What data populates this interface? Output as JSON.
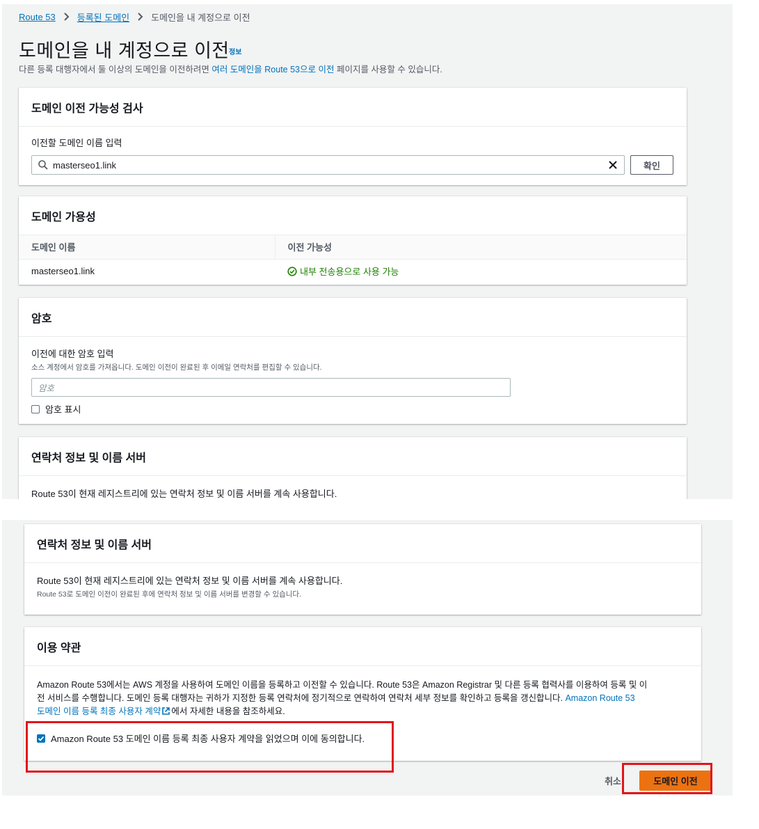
{
  "breadcrumb": {
    "root": "Route 53",
    "registered": "등록된 도메인",
    "current": "도메인을 내 계정으로 이전"
  },
  "header": {
    "title": "도메인을 내 계정으로 이전",
    "info": "정보",
    "subtitle_pre": "다른 등록 대행자에서 둘 이상의 도메인을 이전하려면 ",
    "subtitle_link": "여러 도메인을 Route 53으로 이전",
    "subtitle_post": " 페이지를 사용할 수 있습니다."
  },
  "check_panel": {
    "title": "도메인 이전 가능성 검사",
    "input_label": "이전할 도메인 이름 입력",
    "input_value": "masterseo1.link",
    "confirm_label": "확인"
  },
  "availability_panel": {
    "title": "도메인 가용성",
    "columns": [
      "도메인 이름",
      "이전 가능성"
    ],
    "rows": [
      {
        "domain": "masterseo1.link",
        "status": "내부 전송용으로 사용 가능"
      }
    ]
  },
  "password_panel": {
    "title": "암호",
    "label": "이전에 대한 암호 입력",
    "description": "소스 계정에서 암호를 가져옵니다. 도메인 이전이 완료된 후 이메일 연락처를 편집할 수 있습니다.",
    "placeholder": "암호",
    "show_password_label": "암호 표시"
  },
  "contact_panel": {
    "title": "연락처 정보 및 이름 서버",
    "text": "Route 53이 현재 레지스트리에 있는 연락처 정보 및 이름 서버를 계속 사용합니다.",
    "note": "Route 53로 도메인 이전이 완료된 후에 연락처 정보 및 이름 서버를 변경할 수 있습니다."
  },
  "terms_panel": {
    "title": "이용 약관",
    "text_line1": "Amazon Route 53에서는 AWS 계정을 사용하여 도메인 이름을 등록하고 이전할 수 있습니다. Route 53은 Amazon Registrar 및 다른 등록 협력사를 이용하여 등록 및 이",
    "text_line2": "전 서비스를 수행합니다. 도메인 등록 대행자는 귀하가 지정한 등록 연락처에 정기적으로 연락하여 연락처 세부 정보를 확인하고 등록을 갱신합니다. ",
    "link_part1": "Amazon Route 53",
    "link_part2": "도메인 이름 등록 최종 사용자 계약",
    "text_tail": "에서 자세한 내용을 참조하세요.",
    "agree_label": "Amazon Route 53 도메인 이름 등록 최종 사용자 계약을 읽었으며 이에 동의합니다."
  },
  "actions": {
    "cancel": "취소",
    "transfer": "도메인 이전"
  },
  "colors": {
    "link": "#0073bb",
    "primary": "#ec7211",
    "success": "#1d8102",
    "highlight": "#e0161b"
  }
}
